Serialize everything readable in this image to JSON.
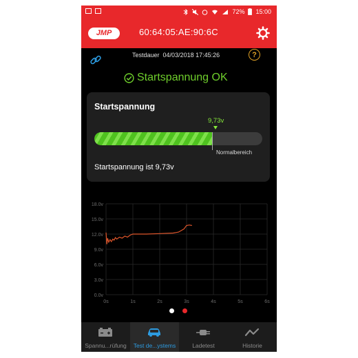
{
  "status_bar": {
    "battery": "72%",
    "time": "15:00"
  },
  "app_bar": {
    "logo_text": "JMP",
    "device_address": "60:64:05:AE:90:6C"
  },
  "info": {
    "test_label": "Testdauer",
    "test_datetime": "04/03/2018 17:45:26",
    "help_glyph": "?"
  },
  "result": {
    "status_text": "Startspannung OK"
  },
  "card": {
    "title": "Startspannung",
    "value_label": "9,73v",
    "fill_fraction": 0.705,
    "range_label": "Normalbereich",
    "message": "Startspannung ist 9,73v"
  },
  "chart_data": {
    "type": "line",
    "y_ticks": [
      "18.0v",
      "15.0v",
      "12.0v",
      "9.0v",
      "6.0v",
      "3.0v",
      "0.0v"
    ],
    "x_ticks": [
      "0s",
      "1s",
      "2s",
      "3s",
      "4s",
      "5s",
      "6s"
    ],
    "xlim": [
      0,
      6
    ],
    "ylim": [
      0,
      18
    ],
    "grid": true,
    "series": [
      {
        "color": "#e0562b",
        "x": [
          0,
          0.03,
          0.06,
          0.1,
          0.15,
          0.2,
          0.25,
          0.3,
          0.35,
          0.4,
          0.5,
          0.6,
          0.7,
          0.8,
          0.9,
          1.0,
          1.2,
          1.5,
          2.0,
          2.5,
          2.7,
          2.9,
          3.0,
          3.1,
          3.2
        ],
        "y": [
          12.3,
          10.0,
          11.2,
          10.4,
          10.9,
          10.5,
          11.0,
          10.8,
          11.3,
          11.0,
          11.4,
          11.2,
          11.6,
          11.4,
          11.8,
          12.0,
          12.0,
          12.0,
          12.1,
          12.2,
          12.4,
          13.0,
          13.7,
          13.8,
          13.7
        ]
      }
    ]
  },
  "pager": {
    "active_index": 1,
    "count": 2
  },
  "nav": {
    "items": [
      {
        "label": "Spannu...rüfung"
      },
      {
        "label": "Test de...ystems"
      },
      {
        "label": "Ladetest"
      },
      {
        "label": "Historie"
      }
    ]
  },
  "colors": {
    "brand_red": "#e8282b",
    "ok_green": "#6fcf2c",
    "accent_blue": "#2d9be0",
    "warning_orange": "#e1a126"
  }
}
